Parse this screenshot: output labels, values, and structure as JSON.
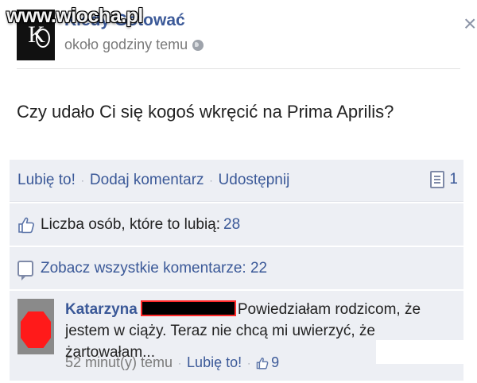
{
  "watermark": {
    "text": "www.wiocha.pl"
  },
  "header": {
    "avatar_letter": "K",
    "page_name": "Kiedy Gotować",
    "post_time": "około godziny temu",
    "privacy_icon": "globe-icon",
    "close_glyph": "×"
  },
  "post": {
    "text": "Czy udało Ci się kogoś wkręcić na Prima Aprilis?"
  },
  "actions": {
    "like": "Lubię to!",
    "comment": "Dodaj komentarz",
    "share": "Udostępnij",
    "separator": "·",
    "share_count": "1"
  },
  "likes": {
    "text": "Liczba osób, które to lubią: ",
    "count": "28"
  },
  "comments_link": {
    "text": "Zobacz wszystkie komentarze: 22"
  },
  "comment": {
    "author": "Katarzyna",
    "text": "Powiedziałam rodzicom, że jestem w ciąży. Teraz nie chcą mi uwierzyć, że żartowałam...",
    "time": "52 minut(y) temu",
    "separator": "·",
    "like_label": "Lubię to!",
    "like_count": "9"
  },
  "colors": {
    "link": "#3b5998",
    "panel": "#edeff4",
    "redaction_red": "#ff1a1a"
  }
}
